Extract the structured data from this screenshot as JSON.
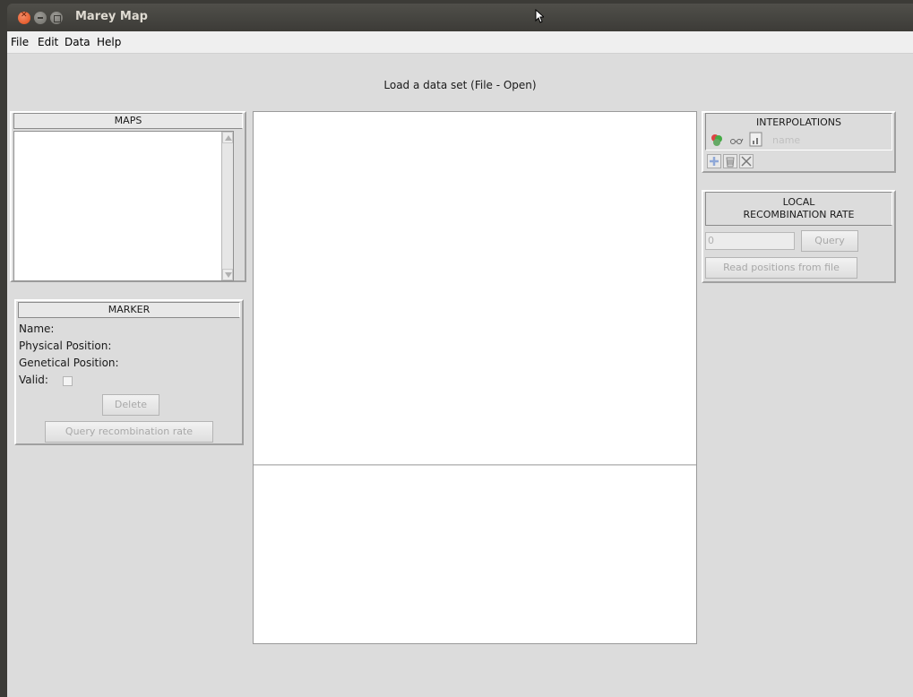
{
  "window": {
    "title": "Marey Map"
  },
  "menu": {
    "items": [
      "File",
      "Edit",
      "Data",
      "Help"
    ]
  },
  "status_message": "Load a data set (File - Open)",
  "maps_panel": {
    "title": "MAPS"
  },
  "marker_panel": {
    "title": "MARKER",
    "name_label": "Name:",
    "physical_label": "Physical Position:",
    "genetical_label": "Genetical Position:",
    "valid_label": "Valid:",
    "delete_button": "Delete",
    "query_button": "Query recombination rate"
  },
  "interpolations_panel": {
    "title": "INTERPOLATIONS",
    "name_placeholder": "name"
  },
  "recombination_panel": {
    "title_line1": "LOCAL",
    "title_line2": "RECOMBINATION RATE",
    "input_value": "0",
    "query_button": "Query",
    "read_button": "Read positions from file"
  },
  "colors": {
    "titlebar": "#3c3b37",
    "surface": "#dcdcdc",
    "close_button": "#df4a16"
  }
}
